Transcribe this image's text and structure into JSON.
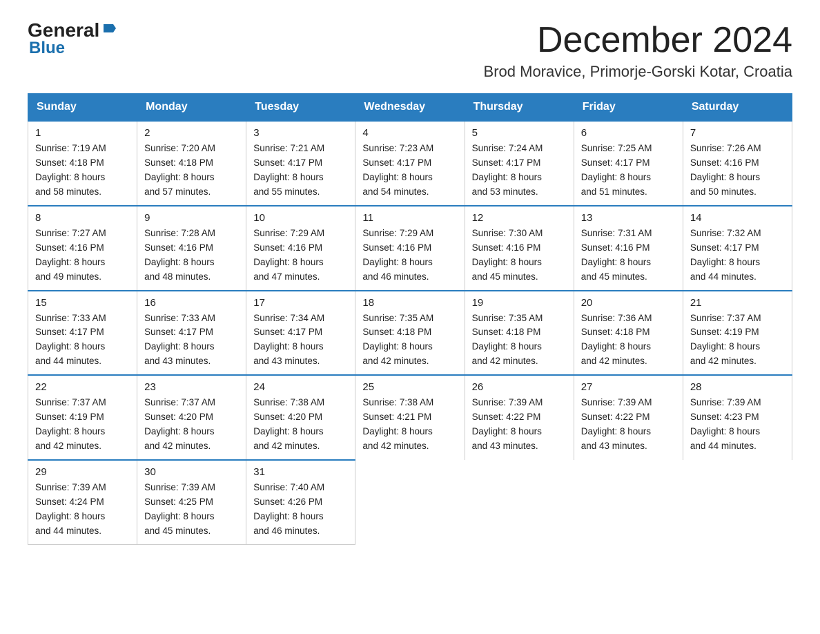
{
  "header": {
    "logo_general": "General",
    "logo_blue": "Blue",
    "month_title": "December 2024",
    "location": "Brod Moravice, Primorje-Gorski Kotar, Croatia"
  },
  "weekdays": [
    "Sunday",
    "Monday",
    "Tuesday",
    "Wednesday",
    "Thursday",
    "Friday",
    "Saturday"
  ],
  "weeks": [
    [
      {
        "day": "1",
        "sunrise": "7:19 AM",
        "sunset": "4:18 PM",
        "daylight": "8 hours and 58 minutes."
      },
      {
        "day": "2",
        "sunrise": "7:20 AM",
        "sunset": "4:18 PM",
        "daylight": "8 hours and 57 minutes."
      },
      {
        "day": "3",
        "sunrise": "7:21 AM",
        "sunset": "4:17 PM",
        "daylight": "8 hours and 55 minutes."
      },
      {
        "day": "4",
        "sunrise": "7:23 AM",
        "sunset": "4:17 PM",
        "daylight": "8 hours and 54 minutes."
      },
      {
        "day": "5",
        "sunrise": "7:24 AM",
        "sunset": "4:17 PM",
        "daylight": "8 hours and 53 minutes."
      },
      {
        "day": "6",
        "sunrise": "7:25 AM",
        "sunset": "4:17 PM",
        "daylight": "8 hours and 51 minutes."
      },
      {
        "day": "7",
        "sunrise": "7:26 AM",
        "sunset": "4:16 PM",
        "daylight": "8 hours and 50 minutes."
      }
    ],
    [
      {
        "day": "8",
        "sunrise": "7:27 AM",
        "sunset": "4:16 PM",
        "daylight": "8 hours and 49 minutes."
      },
      {
        "day": "9",
        "sunrise": "7:28 AM",
        "sunset": "4:16 PM",
        "daylight": "8 hours and 48 minutes."
      },
      {
        "day": "10",
        "sunrise": "7:29 AM",
        "sunset": "4:16 PM",
        "daylight": "8 hours and 47 minutes."
      },
      {
        "day": "11",
        "sunrise": "7:29 AM",
        "sunset": "4:16 PM",
        "daylight": "8 hours and 46 minutes."
      },
      {
        "day": "12",
        "sunrise": "7:30 AM",
        "sunset": "4:16 PM",
        "daylight": "8 hours and 45 minutes."
      },
      {
        "day": "13",
        "sunrise": "7:31 AM",
        "sunset": "4:16 PM",
        "daylight": "8 hours and 45 minutes."
      },
      {
        "day": "14",
        "sunrise": "7:32 AM",
        "sunset": "4:17 PM",
        "daylight": "8 hours and 44 minutes."
      }
    ],
    [
      {
        "day": "15",
        "sunrise": "7:33 AM",
        "sunset": "4:17 PM",
        "daylight": "8 hours and 44 minutes."
      },
      {
        "day": "16",
        "sunrise": "7:33 AM",
        "sunset": "4:17 PM",
        "daylight": "8 hours and 43 minutes."
      },
      {
        "day": "17",
        "sunrise": "7:34 AM",
        "sunset": "4:17 PM",
        "daylight": "8 hours and 43 minutes."
      },
      {
        "day": "18",
        "sunrise": "7:35 AM",
        "sunset": "4:18 PM",
        "daylight": "8 hours and 42 minutes."
      },
      {
        "day": "19",
        "sunrise": "7:35 AM",
        "sunset": "4:18 PM",
        "daylight": "8 hours and 42 minutes."
      },
      {
        "day": "20",
        "sunrise": "7:36 AM",
        "sunset": "4:18 PM",
        "daylight": "8 hours and 42 minutes."
      },
      {
        "day": "21",
        "sunrise": "7:37 AM",
        "sunset": "4:19 PM",
        "daylight": "8 hours and 42 minutes."
      }
    ],
    [
      {
        "day": "22",
        "sunrise": "7:37 AM",
        "sunset": "4:19 PM",
        "daylight": "8 hours and 42 minutes."
      },
      {
        "day": "23",
        "sunrise": "7:37 AM",
        "sunset": "4:20 PM",
        "daylight": "8 hours and 42 minutes."
      },
      {
        "day": "24",
        "sunrise": "7:38 AM",
        "sunset": "4:20 PM",
        "daylight": "8 hours and 42 minutes."
      },
      {
        "day": "25",
        "sunrise": "7:38 AM",
        "sunset": "4:21 PM",
        "daylight": "8 hours and 42 minutes."
      },
      {
        "day": "26",
        "sunrise": "7:39 AM",
        "sunset": "4:22 PM",
        "daylight": "8 hours and 43 minutes."
      },
      {
        "day": "27",
        "sunrise": "7:39 AM",
        "sunset": "4:22 PM",
        "daylight": "8 hours and 43 minutes."
      },
      {
        "day": "28",
        "sunrise": "7:39 AM",
        "sunset": "4:23 PM",
        "daylight": "8 hours and 44 minutes."
      }
    ],
    [
      {
        "day": "29",
        "sunrise": "7:39 AM",
        "sunset": "4:24 PM",
        "daylight": "8 hours and 44 minutes."
      },
      {
        "day": "30",
        "sunrise": "7:39 AM",
        "sunset": "4:25 PM",
        "daylight": "8 hours and 45 minutes."
      },
      {
        "day": "31",
        "sunrise": "7:40 AM",
        "sunset": "4:26 PM",
        "daylight": "8 hours and 46 minutes."
      },
      null,
      null,
      null,
      null
    ]
  ],
  "labels": {
    "sunrise": "Sunrise:",
    "sunset": "Sunset:",
    "daylight": "Daylight:"
  }
}
